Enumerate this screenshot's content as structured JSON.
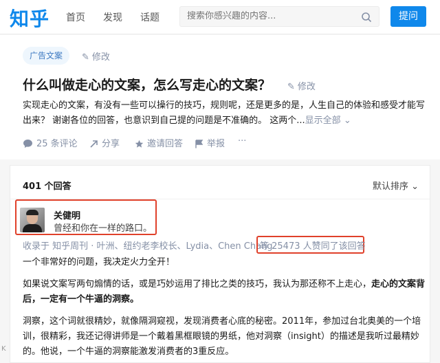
{
  "header": {
    "logo": "知乎",
    "nav": [
      "首页",
      "发现",
      "话题"
    ],
    "search_placeholder": "搜索你感兴趣的内容...",
    "ask_label": "提问"
  },
  "question": {
    "topic": "广告文案",
    "edit_label": "修改",
    "title": "什么叫做走心的文案，怎么写走心的文案？",
    "description": "实现走心的文案，有没有一些可以操行的技巧，规则呢，还是更多的是，人生自己的体验和感受才能写出来？ 谢谢各位的回答，也意识到自己提的问题是不准确的。 这两个...",
    "show_all": "显示全部",
    "actions": {
      "comments": "25 条评论",
      "share": "分享",
      "invite": "邀请回答",
      "report": "举报",
      "more": "···"
    }
  },
  "answers": {
    "count": "401 个回答",
    "sort": "默认排序",
    "author_name": "关健明",
    "author_bio": "曾经和你在一样的路口。",
    "collected_by": "收录于 知乎周刊 · 叶洲、纽约老李校长、Lydia、Chen Chang",
    "likes": "等 25473 人赞同了该回答",
    "p1": "一个非常好的问题，我决定火力全开！",
    "p2_a": "如果说文案写两句煽情的话，或是巧妙运用了排比之类的技巧，我认为那还称不上走心，",
    "p2_b": "走心的文案背后，一定有一个牛逼的洞察。",
    "p3": "洞察，这个词就很精妙，就像隔洞窥视，发现消费者心底的秘密。2011年，参加过台北奥美的一个培训，很精彩，我还记得讲师是一个戴着黑框眼镜的男纸，他对洞察（insight）的描述是我听过最精妙的。他说，一个牛逼的洞察能激发消费者的3重反应。"
  },
  "watermark": "K"
}
